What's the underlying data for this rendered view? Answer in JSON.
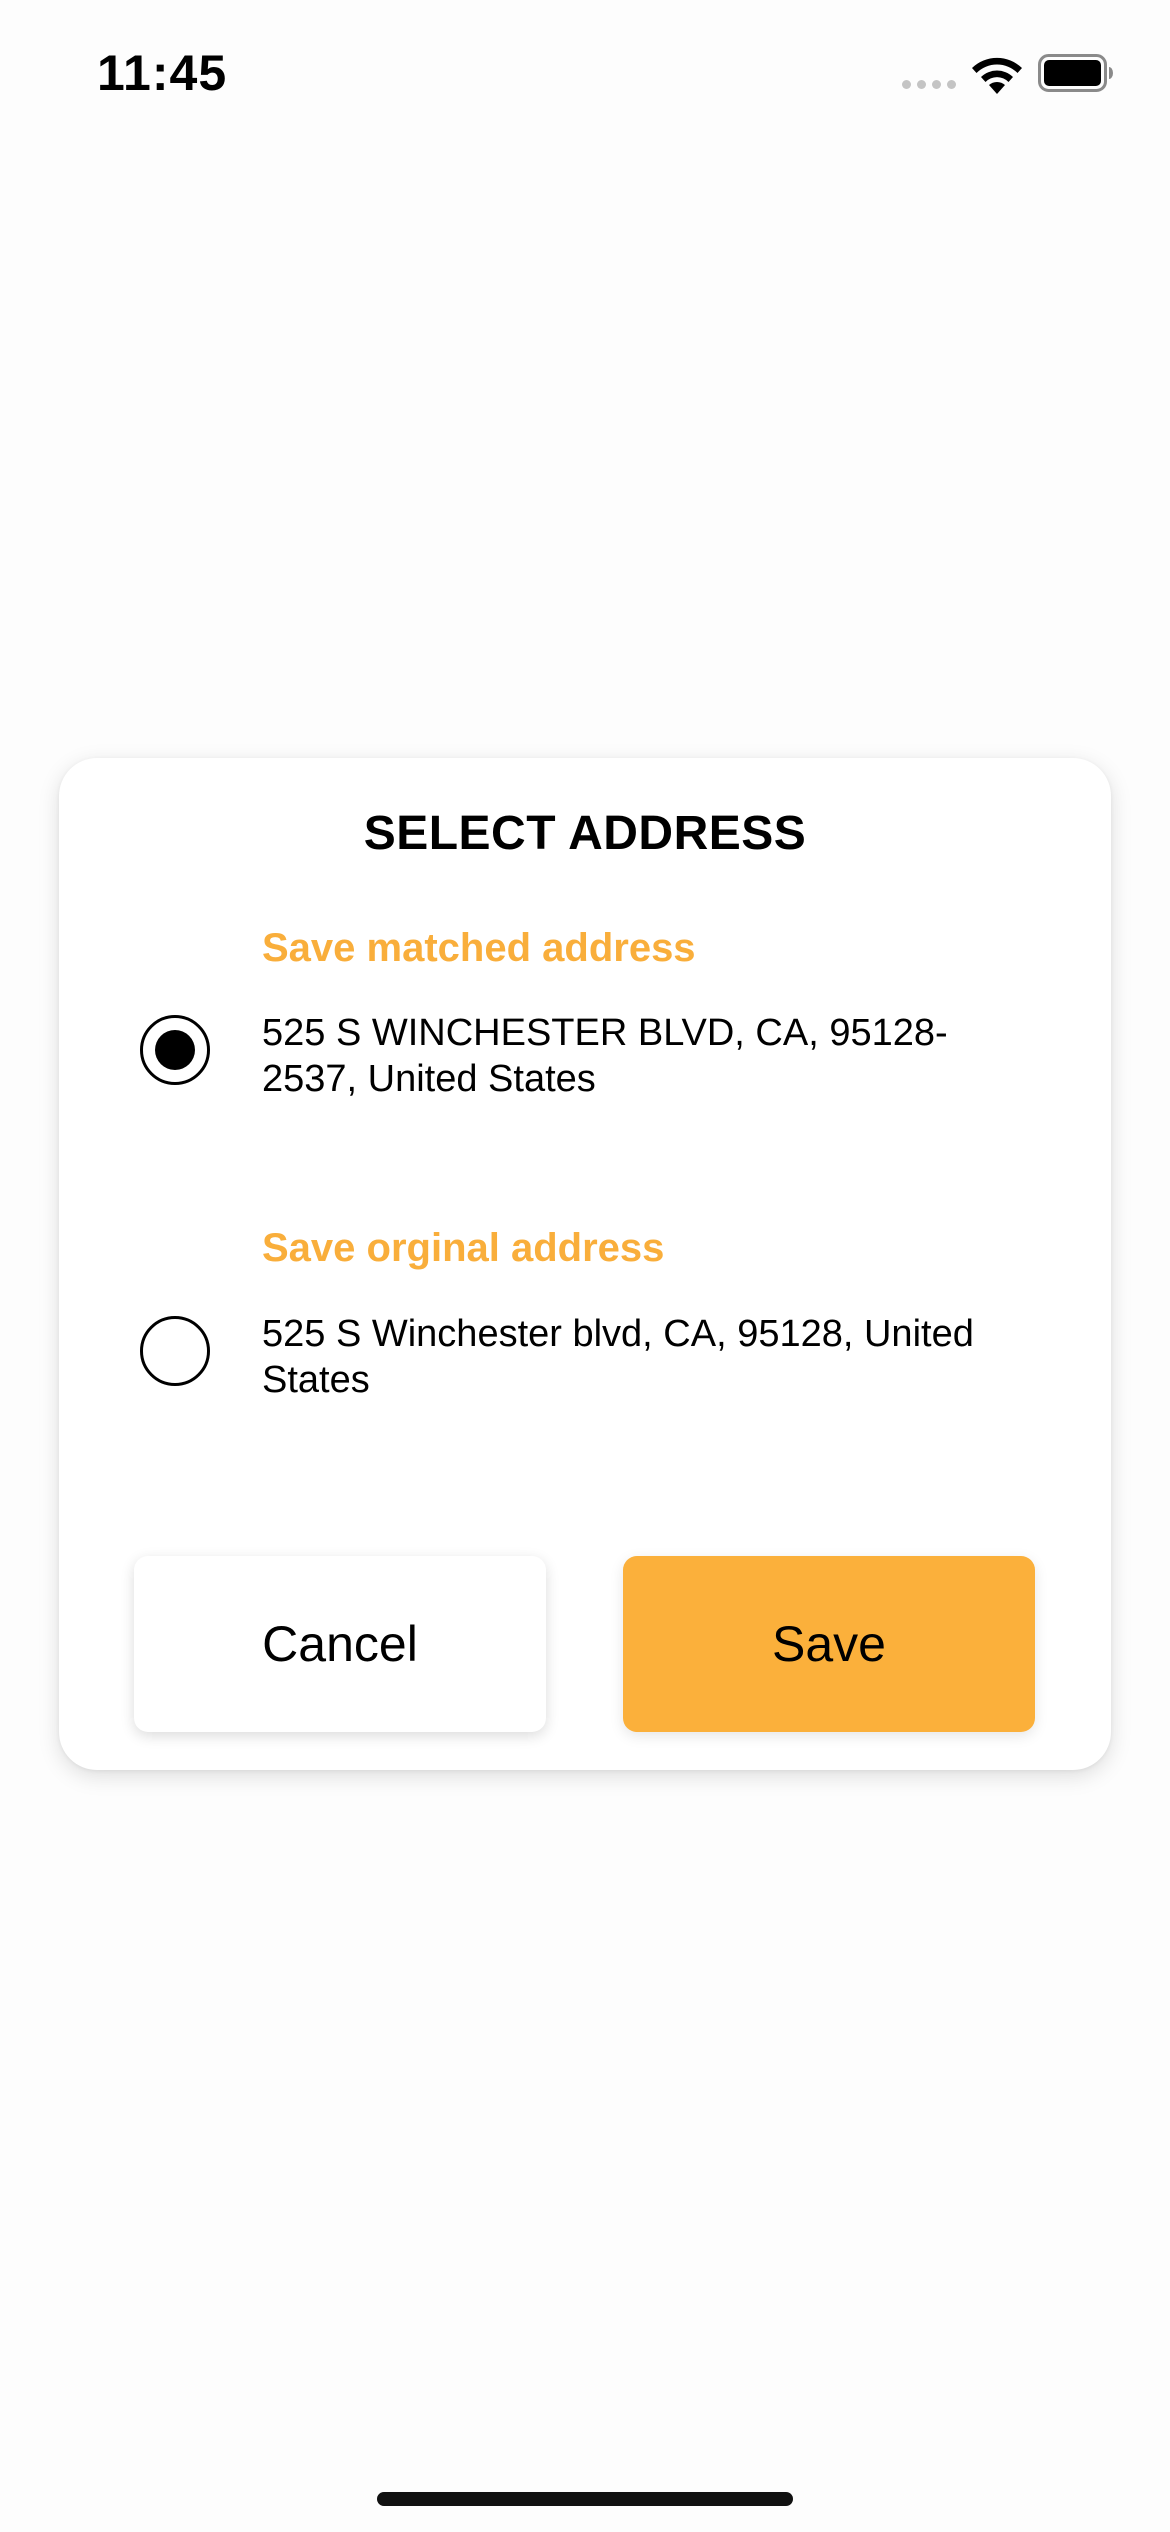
{
  "status_bar": {
    "time": "11:45",
    "icons": [
      "cellular-signal-icon",
      "wifi-icon",
      "battery-icon"
    ]
  },
  "dialog": {
    "title": "SELECT ADDRESS",
    "options": [
      {
        "heading": "Save matched address",
        "address": "525 S WINCHESTER BLVD, CA, 95128-2537, United States",
        "selected": true
      },
      {
        "heading": "Save orginal address",
        "address": "525 S Winchester blvd, CA, 95128, United States",
        "selected": false
      }
    ],
    "buttons": {
      "cancel_label": "Cancel",
      "save_label": "Save"
    }
  },
  "colors": {
    "accent": "#f9ae3b",
    "save_button": "#fbb03b",
    "background": "#fdfdfd"
  }
}
